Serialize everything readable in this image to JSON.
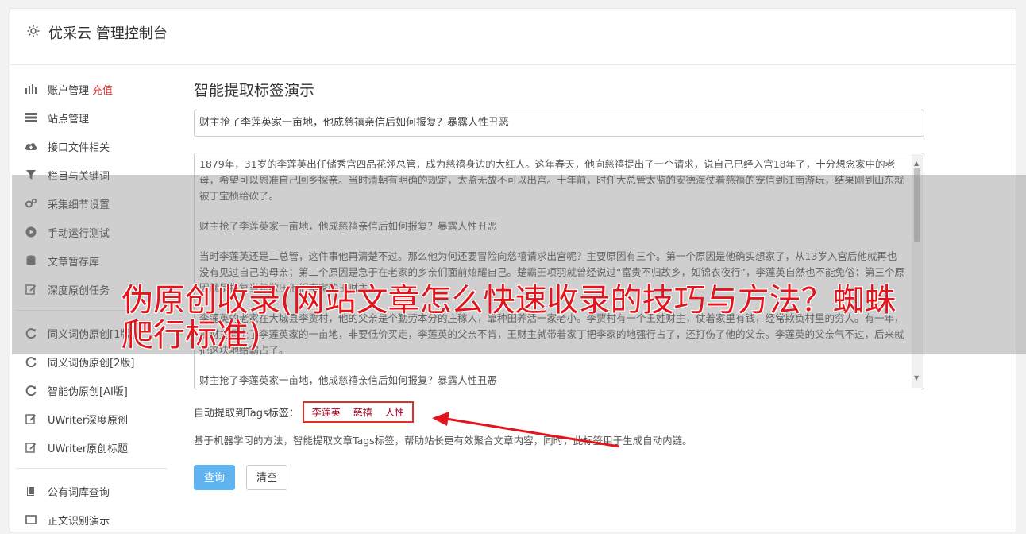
{
  "header": {
    "title": "优采云 管理控制台",
    "icon": "gear-icon"
  },
  "sidebar": {
    "items": [
      {
        "label": "账户管理",
        "badge": "充值",
        "icon": "bar-chart-icon"
      },
      {
        "label": "站点管理",
        "icon": "server-icon"
      },
      {
        "label": "接口文件相关",
        "icon": "cloud-upload-icon"
      },
      {
        "label": "栏目与关键词",
        "icon": "filter-icon"
      },
      {
        "label": "采集细节设置",
        "icon": "cogs-icon"
      },
      {
        "label": "手动运行测试",
        "icon": "play-circle-icon"
      },
      {
        "label": "文章暂存库",
        "icon": "database-icon"
      },
      {
        "label": "深度原创任务",
        "icon": "edit-icon"
      }
    ],
    "items2": [
      {
        "label": "同义词伪原创[1版]",
        "icon": "refresh-icon"
      },
      {
        "label": "同义词伪原创[2版]",
        "icon": "refresh-icon"
      },
      {
        "label": "智能伪原创[AI版]",
        "icon": "refresh-icon"
      },
      {
        "label": "UWriter深度原创",
        "icon": "edit-icon"
      },
      {
        "label": "UWriter原创标题",
        "icon": "edit-icon"
      }
    ],
    "items3": [
      {
        "label": "公有词库查询",
        "icon": "book-icon"
      },
      {
        "label": "正文识别演示",
        "icon": "window-icon"
      }
    ]
  },
  "main": {
    "heading": "智能提取标签演示",
    "title_value": "财主抢了李莲英家一亩地，他成慈禧亲信后如何报复？暴露人性丑恶",
    "paragraphs": [
      "1879年，31岁的李莲英出任储秀宫四品花翎总管，成为慈禧身边的大红人。这年春天，他向慈禧提出了一个请求，说自己已经入宫18年了，十分想念家中的老母，希望可以恩准自己回乡探亲。当时清朝有明确的规定，太监无故不可以出宫。十年前，时任大总管太监的安德海仗着慈禧的宠信到江南游玩，结果刚到山东就被丁宝桢给砍了。",
      "财主抢了李莲英家一亩地，他成慈禧亲信后如何报复？暴露人性丑恶",
      "当时李莲英还是二总管，这件事他再清楚不过。那么他为何还要冒险向慈禧请求出宫呢？主要原因有三个。第一个原因是他确实想家了，从13岁入宫后他就再也没有见过自己的母亲；第二个原因是急于在老家的乡亲们面前炫耀自己。楚霸王项羽就曾经说过“富贵不归故乡，如锦衣夜行”，李莲英自然也不能免俗；第三个原因就是报复当年欺压他们李家的王财主。",
      "李莲英的老家在大城县李贾村，他的父亲是个勤劳本分的庄稼人，靠种田养活一家老小。李贾村有一个王姓财主，仗着家里有钱，经常欺负村里的穷人。有一年，王财主看上了李莲英家的一亩地，非要低价买走，李莲英的父亲不肯，王财主就带着家丁把李家的地强行占了，还打伤了他的父亲。李莲英的父亲气不过，后来就把这块地给霸占了。",
      "财主抢了李莲英家一亩地，他成慈禧亲信后如何报复？暴露人性丑恶"
    ],
    "tags_label": "自动提取到Tags标签：",
    "tags": [
      "李莲英",
      "慈禧",
      "人性"
    ],
    "description": "基于机器学习的方法，智能提取文章Tags标签，帮助站长更有效聚合文章内容，同时，此标签用于生成自动内链。",
    "query_button": "查询",
    "clear_button": "清空"
  },
  "watermark": "伪原创收录(网站文章怎么快速收录的技巧与方法？蜘蛛爬行标准)",
  "colors": {
    "accent": "#5fb4f0",
    "badge": "#e4393c",
    "tag_border": "#d9302e",
    "watermark": "#e3141b"
  }
}
